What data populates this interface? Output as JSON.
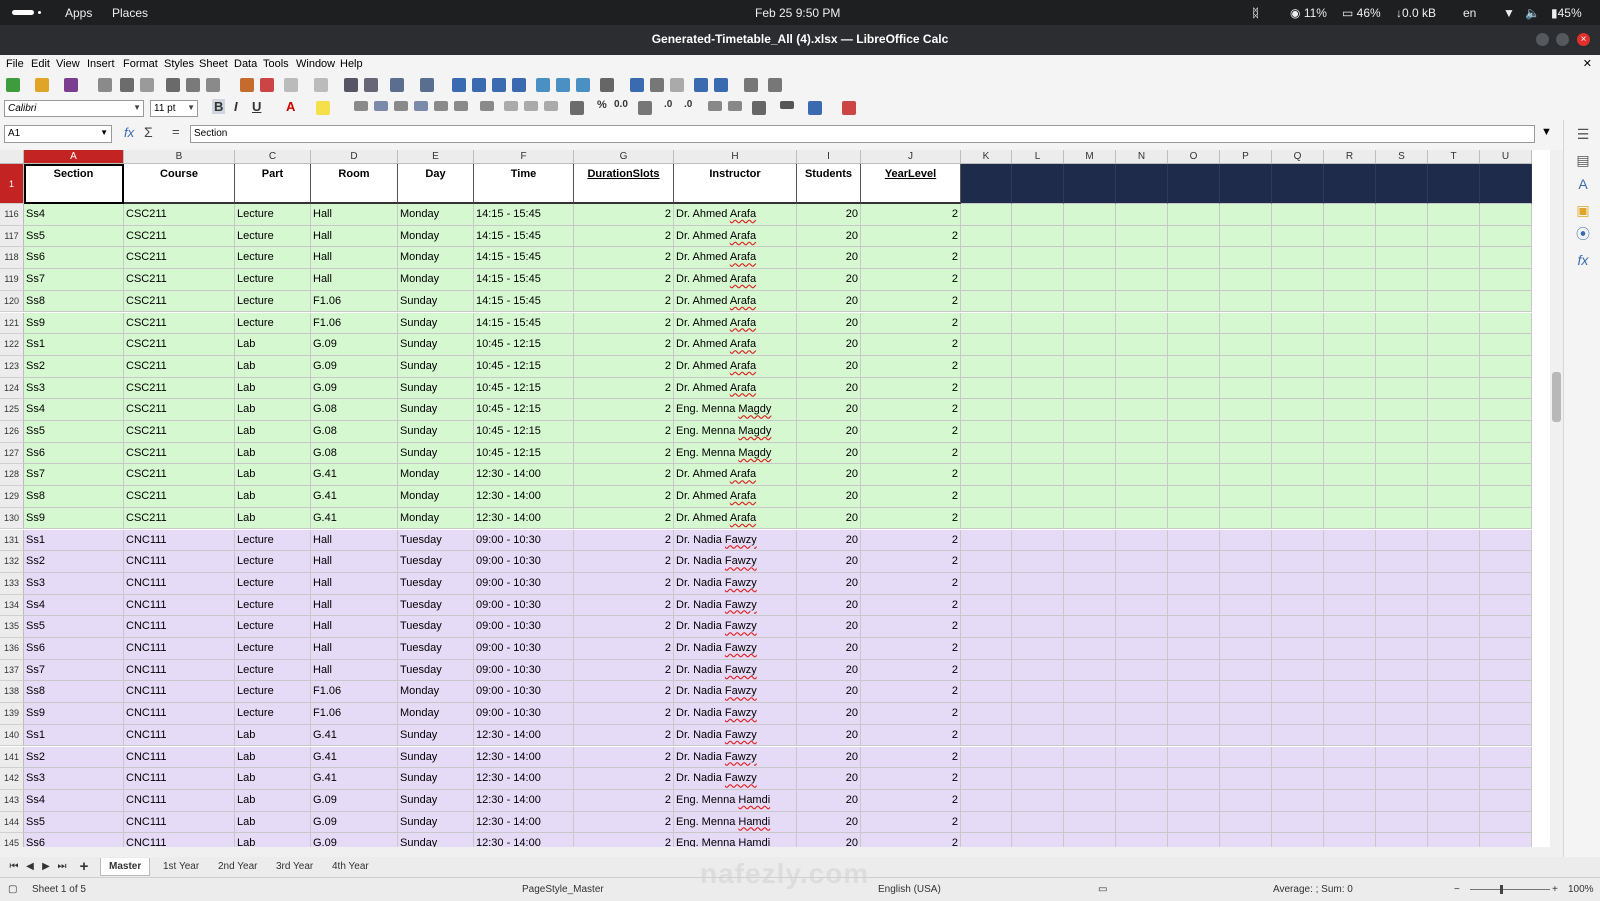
{
  "system_bar": {
    "apps": "Apps",
    "places": "Places",
    "datetime": "Feb 25   9:50 PM",
    "cpu": "11%",
    "battery_meter": "46%",
    "network": "0.0 kB",
    "lang": "en",
    "battery": "45%"
  },
  "window": {
    "title": "Generated-Timetable_All (4).xlsx — LibreOffice Calc"
  },
  "menu": [
    "File",
    "Edit",
    "View",
    "Insert",
    "Format",
    "Styles",
    "Sheet",
    "Data",
    "Tools",
    "Window",
    "Help"
  ],
  "toolbar": {
    "font_name": "Calibri",
    "font_size": "11 pt"
  },
  "formula_bar": {
    "cell_ref": "A1",
    "content": "Section"
  },
  "columns": [
    "A",
    "B",
    "C",
    "D",
    "E",
    "F",
    "G",
    "H",
    "I",
    "J",
    "K",
    "L",
    "M",
    "N",
    "O",
    "P",
    "Q",
    "R",
    "S",
    "T",
    "U"
  ],
  "header_row": {
    "row_number": "1",
    "cells": [
      "Section",
      "Course",
      "Part",
      "Room",
      "Day",
      "Time",
      "DurationSlots",
      "Instructor",
      "Students",
      "YearLevel"
    ]
  },
  "colors": {
    "green_rows": "#d6f8d0",
    "purple_rows": "#e6dbf7",
    "header_fill": "#1f2b4a",
    "selection": "#c32423"
  },
  "rows": [
    {
      "num": "116",
      "c": [
        "Ss4",
        "CSC211",
        "Lecture",
        "Hall",
        "Monday",
        "14:15 - 15:45",
        "2",
        "Dr. Ahmed Arafa",
        "20",
        "2"
      ]
    },
    {
      "num": "117",
      "c": [
        "Ss5",
        "CSC211",
        "Lecture",
        "Hall",
        "Monday",
        "14:15 - 15:45",
        "2",
        "Dr. Ahmed Arafa",
        "20",
        "2"
      ]
    },
    {
      "num": "118",
      "c": [
        "Ss6",
        "CSC211",
        "Lecture",
        "Hall",
        "Monday",
        "14:15 - 15:45",
        "2",
        "Dr. Ahmed Arafa",
        "20",
        "2"
      ]
    },
    {
      "num": "119",
      "c": [
        "Ss7",
        "CSC211",
        "Lecture",
        "Hall",
        "Monday",
        "14:15 - 15:45",
        "2",
        "Dr. Ahmed Arafa",
        "20",
        "2"
      ]
    },
    {
      "num": "120",
      "c": [
        "Ss8",
        "CSC211",
        "Lecture",
        "F1.06",
        "Sunday",
        "14:15 - 15:45",
        "2",
        "Dr. Ahmed Arafa",
        "20",
        "2"
      ]
    },
    {
      "num": "121",
      "c": [
        "Ss9",
        "CSC211",
        "Lecture",
        "F1.06",
        "Sunday",
        "14:15 - 15:45",
        "2",
        "Dr. Ahmed Arafa",
        "20",
        "2"
      ]
    },
    {
      "num": "122",
      "c": [
        "Ss1",
        "CSC211",
        "Lab",
        "G.09",
        "Sunday",
        "10:45 - 12:15",
        "2",
        "Dr. Ahmed Arafa",
        "20",
        "2"
      ]
    },
    {
      "num": "123",
      "c": [
        "Ss2",
        "CSC211",
        "Lab",
        "G.09",
        "Sunday",
        "10:45 - 12:15",
        "2",
        "Dr. Ahmed Arafa",
        "20",
        "2"
      ]
    },
    {
      "num": "124",
      "c": [
        "Ss3",
        "CSC211",
        "Lab",
        "G.09",
        "Sunday",
        "10:45 - 12:15",
        "2",
        "Dr. Ahmed Arafa",
        "20",
        "2"
      ]
    },
    {
      "num": "125",
      "c": [
        "Ss4",
        "CSC211",
        "Lab",
        "G.08",
        "Sunday",
        "10:45 - 12:15",
        "2",
        "Eng. Menna Magdy",
        "20",
        "2"
      ]
    },
    {
      "num": "126",
      "c": [
        "Ss5",
        "CSC211",
        "Lab",
        "G.08",
        "Sunday",
        "10:45 - 12:15",
        "2",
        "Eng. Menna Magdy",
        "20",
        "2"
      ]
    },
    {
      "num": "127",
      "c": [
        "Ss6",
        "CSC211",
        "Lab",
        "G.08",
        "Sunday",
        "10:45 - 12:15",
        "2",
        "Eng. Menna Magdy",
        "20",
        "2"
      ]
    },
    {
      "num": "128",
      "c": [
        "Ss7",
        "CSC211",
        "Lab",
        "G.41",
        "Monday",
        "12:30 - 14:00",
        "2",
        "Dr. Ahmed Arafa",
        "20",
        "2"
      ]
    },
    {
      "num": "129",
      "c": [
        "Ss8",
        "CSC211",
        "Lab",
        "G.41",
        "Monday",
        "12:30 - 14:00",
        "2",
        "Dr. Ahmed Arafa",
        "20",
        "2"
      ]
    },
    {
      "num": "130",
      "c": [
        "Ss9",
        "CSC211",
        "Lab",
        "G.41",
        "Monday",
        "12:30 - 14:00",
        "2",
        "Dr. Ahmed Arafa",
        "20",
        "2"
      ]
    },
    {
      "num": "131",
      "c": [
        "Ss1",
        "CNC111",
        "Lecture",
        "Hall",
        "Tuesday",
        "09:00 - 10:30",
        "2",
        "Dr. Nadia Fawzy",
        "20",
        "2"
      ]
    },
    {
      "num": "132",
      "c": [
        "Ss2",
        "CNC111",
        "Lecture",
        "Hall",
        "Tuesday",
        "09:00 - 10:30",
        "2",
        "Dr. Nadia Fawzy",
        "20",
        "2"
      ]
    },
    {
      "num": "133",
      "c": [
        "Ss3",
        "CNC111",
        "Lecture",
        "Hall",
        "Tuesday",
        "09:00 - 10:30",
        "2",
        "Dr. Nadia Fawzy",
        "20",
        "2"
      ]
    },
    {
      "num": "134",
      "c": [
        "Ss4",
        "CNC111",
        "Lecture",
        "Hall",
        "Tuesday",
        "09:00 - 10:30",
        "2",
        "Dr. Nadia Fawzy",
        "20",
        "2"
      ]
    },
    {
      "num": "135",
      "c": [
        "Ss5",
        "CNC111",
        "Lecture",
        "Hall",
        "Tuesday",
        "09:00 - 10:30",
        "2",
        "Dr. Nadia Fawzy",
        "20",
        "2"
      ]
    },
    {
      "num": "136",
      "c": [
        "Ss6",
        "CNC111",
        "Lecture",
        "Hall",
        "Tuesday",
        "09:00 - 10:30",
        "2",
        "Dr. Nadia Fawzy",
        "20",
        "2"
      ]
    },
    {
      "num": "137",
      "c": [
        "Ss7",
        "CNC111",
        "Lecture",
        "Hall",
        "Tuesday",
        "09:00 - 10:30",
        "2",
        "Dr. Nadia Fawzy",
        "20",
        "2"
      ]
    },
    {
      "num": "138",
      "c": [
        "Ss8",
        "CNC111",
        "Lecture",
        "F1.06",
        "Monday",
        "09:00 - 10:30",
        "2",
        "Dr. Nadia Fawzy",
        "20",
        "2"
      ]
    },
    {
      "num": "139",
      "c": [
        "Ss9",
        "CNC111",
        "Lecture",
        "F1.06",
        "Monday",
        "09:00 - 10:30",
        "2",
        "Dr. Nadia Fawzy",
        "20",
        "2"
      ]
    },
    {
      "num": "140",
      "c": [
        "Ss1",
        "CNC111",
        "Lab",
        "G.41",
        "Sunday",
        "12:30 - 14:00",
        "2",
        "Dr. Nadia Fawzy",
        "20",
        "2"
      ]
    },
    {
      "num": "141",
      "c": [
        "Ss2",
        "CNC111",
        "Lab",
        "G.41",
        "Sunday",
        "12:30 - 14:00",
        "2",
        "Dr. Nadia Fawzy",
        "20",
        "2"
      ]
    },
    {
      "num": "142",
      "c": [
        "Ss3",
        "CNC111",
        "Lab",
        "G.41",
        "Sunday",
        "12:30 - 14:00",
        "2",
        "Dr. Nadia Fawzy",
        "20",
        "2"
      ]
    },
    {
      "num": "143",
      "c": [
        "Ss4",
        "CNC111",
        "Lab",
        "G.09",
        "Sunday",
        "12:30 - 14:00",
        "2",
        "Eng. Menna Hamdi",
        "20",
        "2"
      ]
    },
    {
      "num": "144",
      "c": [
        "Ss5",
        "CNC111",
        "Lab",
        "G.09",
        "Sunday",
        "12:30 - 14:00",
        "2",
        "Eng. Menna Hamdi",
        "20",
        "2"
      ]
    },
    {
      "num": "145",
      "c": [
        "Ss6",
        "CNC111",
        "Lab",
        "G.09",
        "Sunday",
        "12:30 - 14:00",
        "2",
        "Eng. Menna Hamdi",
        "20",
        "2"
      ]
    }
  ],
  "sheet_tabs": [
    "Master",
    "1st Year",
    "2nd Year",
    "3rd Year",
    "4th Year"
  ],
  "active_tab": "Master",
  "status": {
    "sheet": "Sheet 1 of 5",
    "page_style": "PageStyle_Master",
    "language": "English (USA)",
    "summary": "Average: ; Sum: 0",
    "zoom": "100%"
  },
  "watermark": "nafezly.com"
}
